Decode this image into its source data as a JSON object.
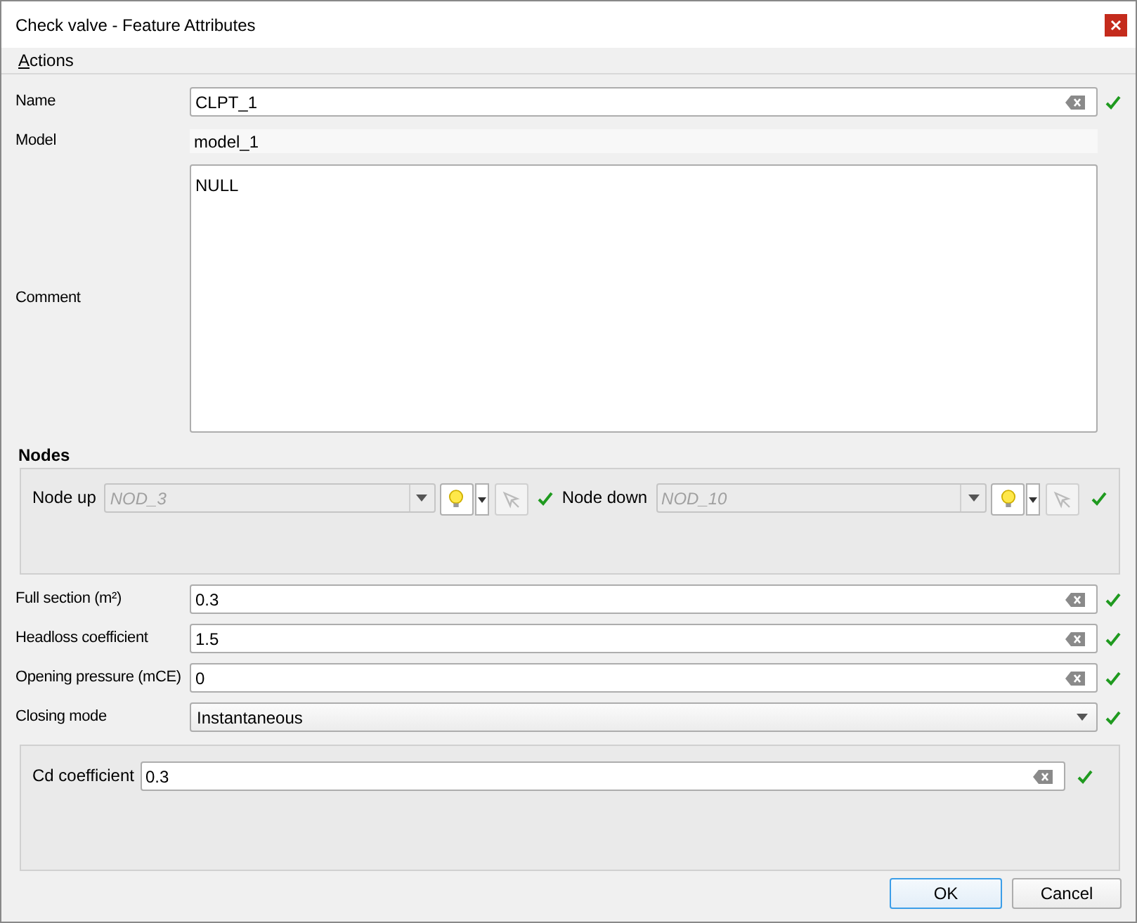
{
  "window": {
    "title": "Check valve - Feature Attributes"
  },
  "menu": [
    "Actions"
  ],
  "name_field": {
    "label": "Name",
    "value": "CLPT_1",
    "valid": true
  },
  "model": {
    "label": "Model",
    "value": "model_1"
  },
  "comment": {
    "label": "Comment",
    "value": "NULL"
  },
  "nodes": {
    "title": "Nodes",
    "items": [
      {
        "label": "Node up",
        "value": "NOD_3",
        "valid": true
      },
      {
        "label": "Node down",
        "value": "NOD_10",
        "valid": true
      }
    ]
  },
  "fields": [
    {
      "kind": "text",
      "label": "Full section (m²)",
      "value": "0.3",
      "valid": true
    },
    {
      "kind": "text",
      "label": "Headloss coefficient",
      "value": "1.5",
      "valid": true
    },
    {
      "kind": "text",
      "label": "Opening pressure (mCE)",
      "value": "0",
      "valid": true
    },
    {
      "kind": "combo",
      "label": "Closing mode",
      "value": "Instantaneous",
      "valid": true
    }
  ],
  "cd": {
    "label": "Cd coefficient",
    "value": "0.3",
    "valid": true
  },
  "buttons": [
    {
      "label": "OK",
      "default": true
    },
    {
      "label": "Cancel",
      "default": false
    }
  ]
}
